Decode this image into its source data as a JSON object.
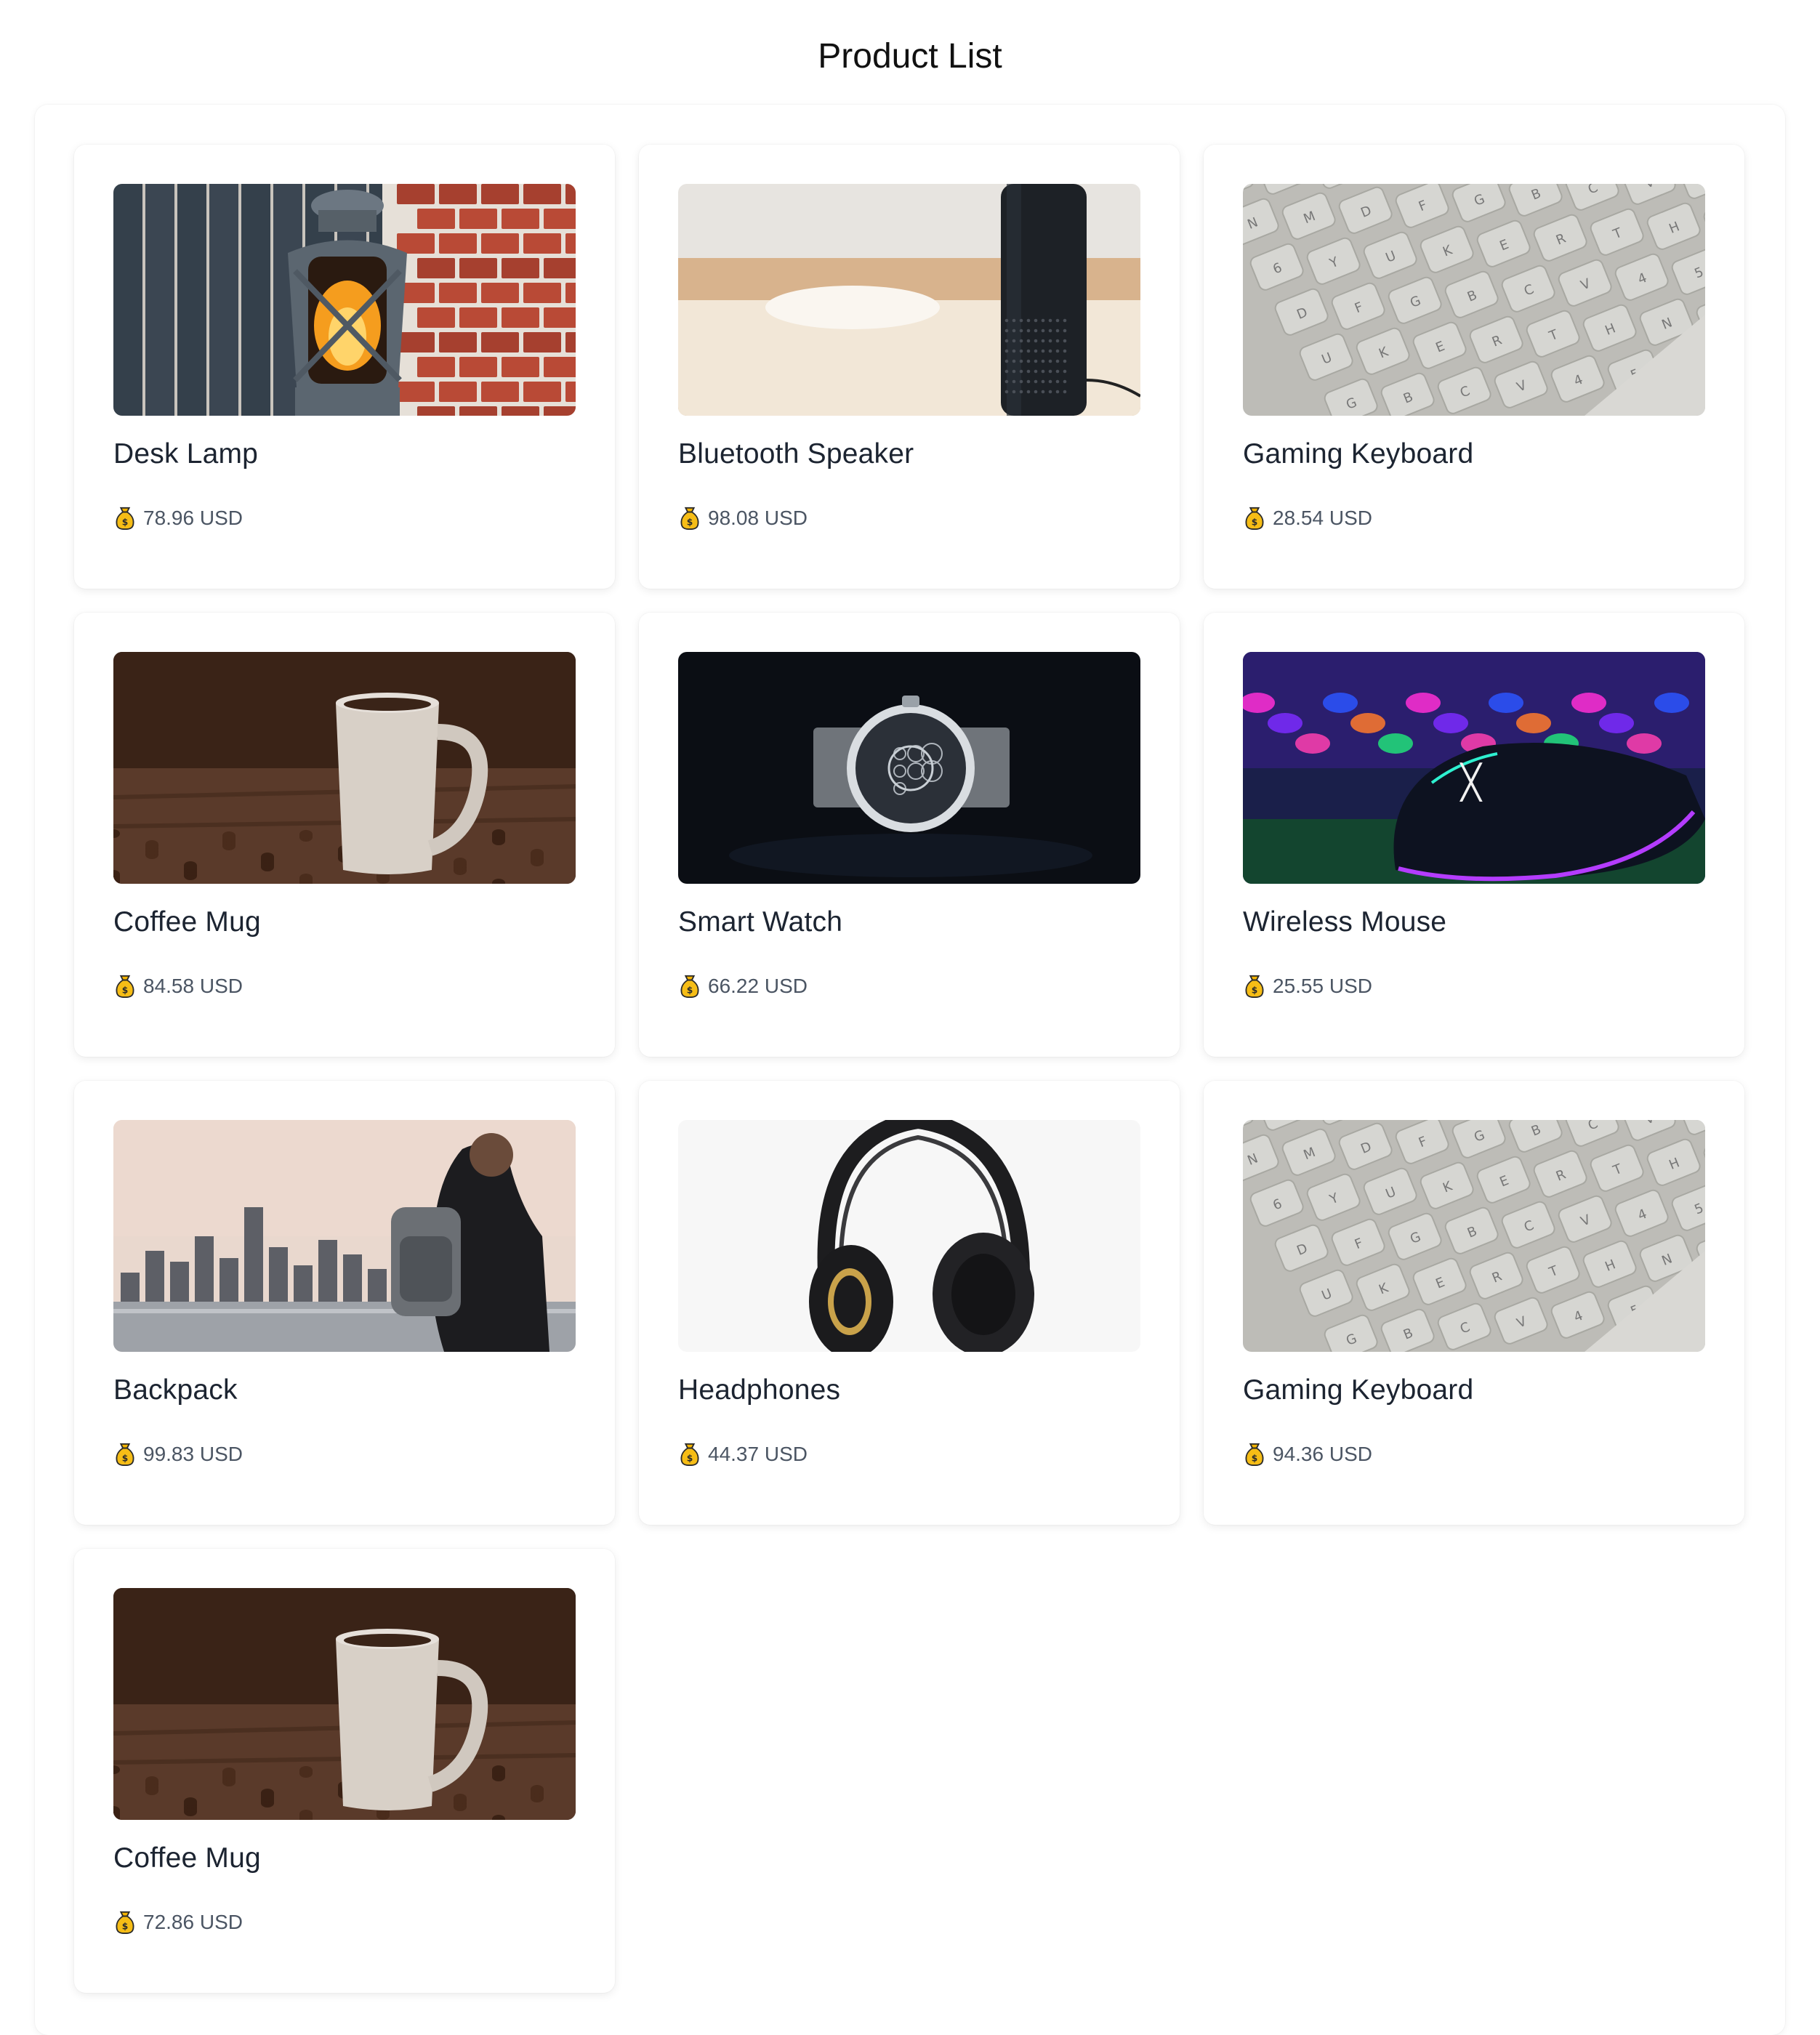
{
  "page": {
    "title": "Product List"
  },
  "products": [
    {
      "name": "Desk Lamp",
      "price": "78.96 USD",
      "image": "lantern"
    },
    {
      "name": "Bluetooth Speaker",
      "price": "98.08 USD",
      "image": "speaker"
    },
    {
      "name": "Gaming Keyboard",
      "price": "28.54 USD",
      "image": "keyboard"
    },
    {
      "name": "Coffee Mug",
      "price": "84.58 USD",
      "image": "mug"
    },
    {
      "name": "Smart Watch",
      "price": "66.22 USD",
      "image": "watch"
    },
    {
      "name": "Wireless Mouse",
      "price": "25.55 USD",
      "image": "mouse"
    },
    {
      "name": "Backpack",
      "price": "99.83 USD",
      "image": "backpack"
    },
    {
      "name": "Headphones",
      "price": "44.37 USD",
      "image": "headphones"
    },
    {
      "name": "Gaming Keyboard",
      "price": "94.36 USD",
      "image": "keyboard"
    },
    {
      "name": "Coffee Mug",
      "price": "72.86 USD",
      "image": "mug"
    }
  ],
  "icons": {
    "price": "money-bag-icon"
  },
  "colors": {
    "title": "#111111",
    "product_name": "#1c2431",
    "price_text": "#4b5563",
    "money_bag": "#f4b400"
  }
}
